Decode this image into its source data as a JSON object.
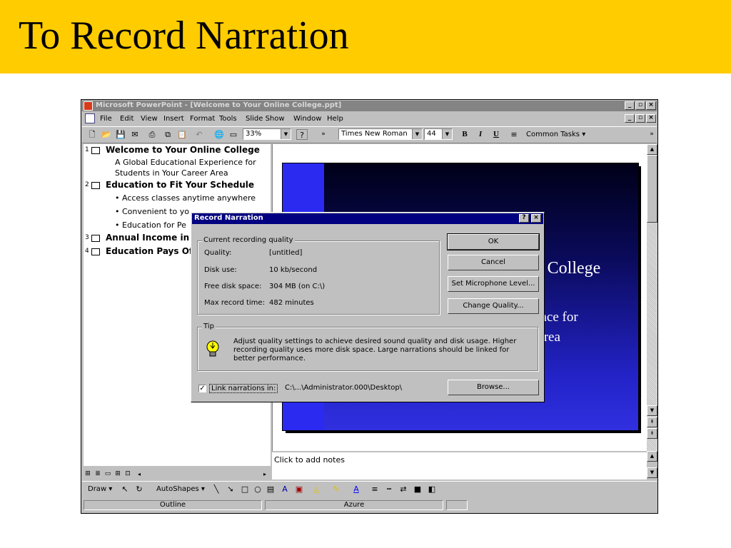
{
  "slide": {
    "title": "To Record Narration"
  },
  "window": {
    "title": "Microsoft PowerPoint - [Welcome to Your Online College.ppt]",
    "controls": {
      "minimize": "_",
      "restore": "3",
      "close": "×"
    }
  },
  "menu": {
    "items": [
      "File",
      "Edit",
      "View",
      "Insert",
      "Format",
      "Tools",
      "Slide Show",
      "Window",
      "Help"
    ]
  },
  "toolbar": {
    "zoom": "33%",
    "font": "Times New Roman",
    "font_size": "44",
    "bold": "B",
    "italic": "I",
    "underline": "U",
    "common_tasks": "Common Tasks",
    "more": "»"
  },
  "outline": {
    "items": [
      {
        "num": "1",
        "title": "Welcome to Your Online College",
        "subs": [
          "A Global Educational Experience for",
          "Students in Your Career Area"
        ]
      },
      {
        "num": "2",
        "title": "Education to Fit Your Schedule",
        "subs": [
          "Access classes anytime anywhere",
          "Convenient to yo",
          "Education for Pe"
        ]
      },
      {
        "num": "3",
        "title": "Annual Income in Sou"
      },
      {
        "num": "4",
        "title": "Education Pays Of"
      }
    ]
  },
  "slide_preview": {
    "title_fragment": "e College",
    "sub_line1": "ence for",
    "sub_line2": "Area"
  },
  "notes": {
    "placeholder": "Click to add notes"
  },
  "drawing_toolbar": {
    "draw": "Draw",
    "autoshapes": "AutoShapes"
  },
  "statusbar": {
    "view": "Outline",
    "design": "Azure"
  },
  "dialog": {
    "title": "Record Narration",
    "help": "?",
    "close": "×",
    "group_quality": "Current recording quality",
    "fields": [
      {
        "label": "Quality:",
        "value": "[untitled]"
      },
      {
        "label": "Disk use:",
        "value": "10 kb/second"
      },
      {
        "label": "Free disk space:",
        "value": "304 MB (on C:\\)"
      },
      {
        "label": "Max record time:",
        "value": "482 minutes"
      }
    ],
    "buttons": {
      "ok": "OK",
      "cancel": "Cancel",
      "mic": "Set Microphone Level...",
      "quality": "Change Quality...",
      "browse": "Browse..."
    },
    "tip_group": "Tip",
    "tip_text": "Adjust quality settings to achieve desired sound quality and disk usage. Higher recording quality uses more disk space. Large narrations should be linked for better performance.",
    "link_label": "Link narrations in:",
    "link_checked": true,
    "link_path": "C:\\...\\Administrator.000\\Desktop\\"
  }
}
